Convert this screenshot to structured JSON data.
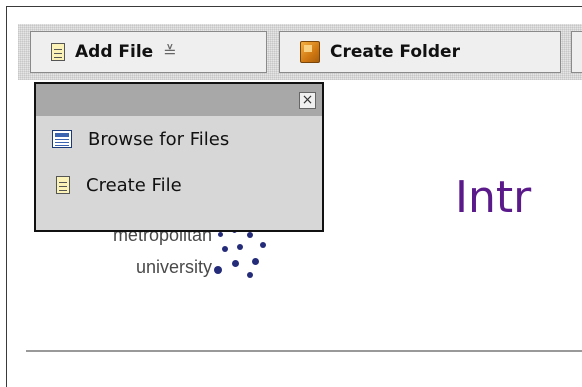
{
  "toolbar": {
    "add_file_label": "Add File",
    "create_folder_label": "Create Folder"
  },
  "dropdown": {
    "close_symbol": "×",
    "items": [
      {
        "label": "Browse for Files",
        "icon": "browse-icon"
      },
      {
        "label": "Create File",
        "icon": "file-icon"
      }
    ]
  },
  "logo": {
    "line1": "metropolitan",
    "line2": "university"
  },
  "page": {
    "title": "Intr"
  },
  "colors": {
    "title": "#5a1a8a",
    "logo_dots": "#242c7a",
    "dropdown_bg": "#d7d7d7"
  }
}
